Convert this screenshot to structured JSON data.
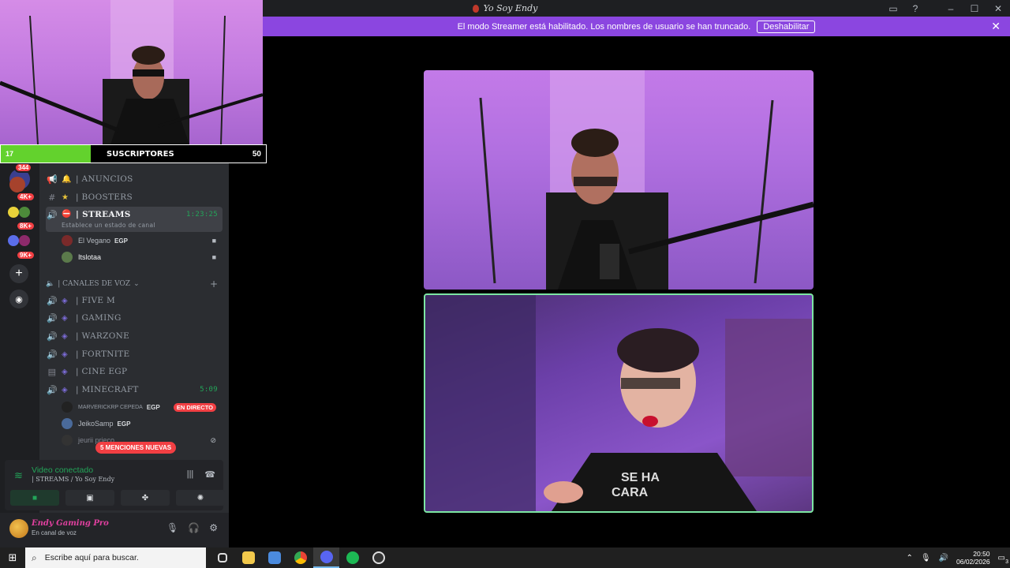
{
  "window": {
    "title": "Yo Soy Endy",
    "buttons": {
      "inbox": "▭",
      "help": "?",
      "minimize": "–",
      "maximize": "☐",
      "close": "✕"
    }
  },
  "banner": {
    "text": "El modo Streamer está habilitado. Los nombres de usuario se han truncado.",
    "button": "Deshabilitar",
    "close": "✕"
  },
  "guilds": {
    "badges": [
      "344",
      "4K+",
      "8K+",
      "9K+"
    ],
    "add_icon": "+",
    "explore_icon": "◉"
  },
  "channels": {
    "items": [
      {
        "name": "| ANUNCIOS",
        "emoji": "🔔"
      },
      {
        "name": "| BOOSTERS",
        "emoji": "★"
      },
      {
        "name": "| STREAMS",
        "emoji": "⛔",
        "time": "1:23:25",
        "status": "Establece un estado de canal"
      }
    ],
    "streams_users": [
      {
        "name": "El Vegano",
        "tag": "EGP"
      },
      {
        "name": "Itslotaa",
        "tag": ""
      }
    ],
    "voice_category": "| CANALES DE VOZ",
    "voice_channels": [
      {
        "name": "| FIVE M"
      },
      {
        "name": "|  GAMING"
      },
      {
        "name": "| WARZONE"
      },
      {
        "name": "| FORTNITE"
      },
      {
        "name": "| CINE EGP"
      },
      {
        "name": "| MINECRAFT",
        "time": "5:09"
      }
    ],
    "minecraft_users": [
      {
        "name": "MARVERICKRP CEPEDA",
        "tag": "EGP",
        "live": "EN DIRECTO"
      },
      {
        "name": "JeikoSamp",
        "tag": "EGP"
      },
      {
        "name": "jeurii prieco",
        "tag": ""
      }
    ],
    "mentions": "5 MENCIONES NUEVAS"
  },
  "voice_panel": {
    "title": "Video conectado",
    "subtitle": "| STREAMS / Yo Soy Endy"
  },
  "user_panel": {
    "name": "Endy Gaming Pro",
    "status": "En canal de voz"
  },
  "webcam_overlay": {
    "current": "17",
    "label": "SUSCRIPTORES",
    "goal": "50",
    "progress": 0.34
  },
  "taskbar": {
    "search_placeholder": "Escribe aquí para buscar.",
    "time": "20:50",
    "date": "06/02/2026",
    "notif_count": "3"
  },
  "colors": {
    "banner": "#8b46e0",
    "green": "#23a559",
    "red_badge": "#f23f43",
    "progress": "#63d22d"
  }
}
